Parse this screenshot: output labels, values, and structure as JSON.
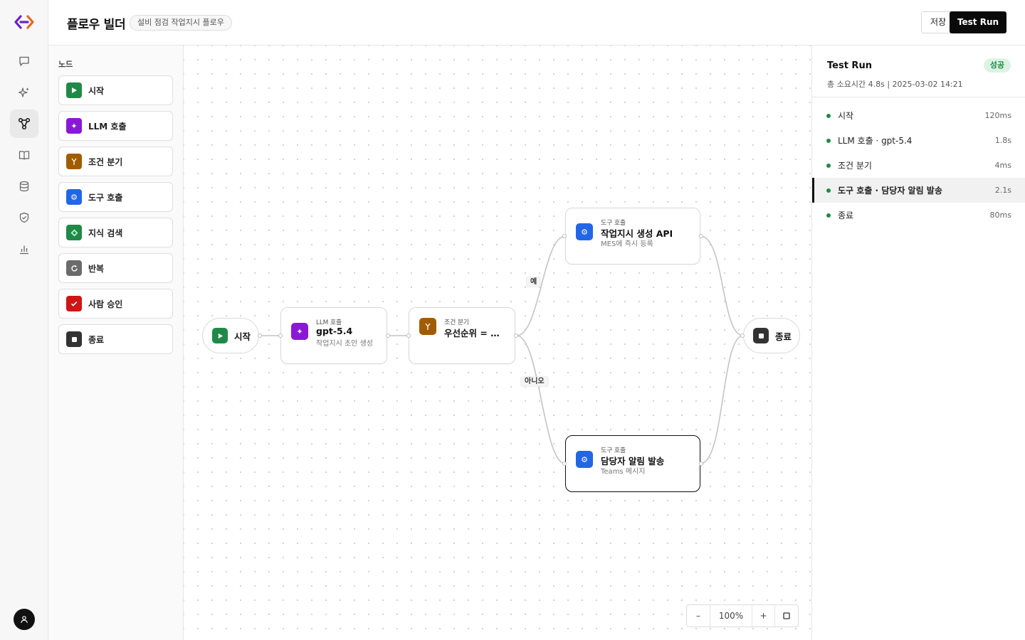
{
  "header": {
    "title": "플로우 빌더",
    "flow_name": "설비 점검 작업지시 플로우",
    "save_label": "저장",
    "run_label": "Test Run"
  },
  "rail": {
    "items": [
      "chat-icon",
      "sparkle-icon",
      "flow-icon",
      "book-icon",
      "database-icon",
      "shield-icon",
      "chart-icon"
    ],
    "active": "flow-icon"
  },
  "palette": {
    "heading": "노드",
    "items": [
      {
        "label": "시작",
        "icon": "play-icon",
        "color": "#1f8a46"
      },
      {
        "label": "LLM 호출",
        "icon": "sparkle-icon",
        "color": "#8b18d6"
      },
      {
        "label": "조건 분기",
        "icon": "branch-icon",
        "color": "#a15c00"
      },
      {
        "label": "도구 호출",
        "icon": "gear-icon",
        "color": "#2266e8"
      },
      {
        "label": "지식 검색",
        "icon": "diamond-icon",
        "color": "#1f8a46"
      },
      {
        "label": "반복",
        "icon": "loop-icon",
        "color": "#6b6b6b"
      },
      {
        "label": "사람 승인",
        "icon": "check-icon",
        "color": "#d01515"
      },
      {
        "label": "종료",
        "icon": "stop-icon",
        "color": "#333333"
      }
    ]
  },
  "canvas": {
    "start": {
      "label": "시작"
    },
    "llm": {
      "type": "LLM 호출",
      "name": "gpt-5.4",
      "desc": "작업지시 초안 생성"
    },
    "cond": {
      "type": "조건 분기",
      "name": "우선순위 = 높음"
    },
    "tool_yes": {
      "type": "도구 호출",
      "name": "작업지시 생성 API",
      "desc": "MES에 즉시 등록"
    },
    "tool_no": {
      "type": "도구 호출",
      "name": "담당자 알림 발송",
      "desc": "Teams 메시지"
    },
    "end": {
      "label": "종료"
    },
    "edge_yes": "예",
    "edge_no": "아니오",
    "zoom": {
      "minus": "–",
      "level": "100%",
      "plus": "+"
    }
  },
  "run": {
    "title": "Test Run",
    "status": "성공",
    "meta": "총 소요시간 4.8s  |  2025-03-02 14:21",
    "steps": [
      {
        "label": "시작",
        "duration": "120ms"
      },
      {
        "label": "LLM 호출 · gpt-5.4",
        "duration": "1.8s"
      },
      {
        "label": "조건 분기",
        "duration": "4ms"
      },
      {
        "label": "도구 호출 · 담당자 알림 발송",
        "duration": "2.1s"
      },
      {
        "label": "종료",
        "duration": "80ms"
      }
    ],
    "active_step": 3
  },
  "colors": {
    "accent": "#0a0a0a",
    "success": "#1f8a46",
    "llm": "#8b18d6",
    "branch": "#a15c00",
    "tool": "#2266e8",
    "approve": "#d01515"
  }
}
